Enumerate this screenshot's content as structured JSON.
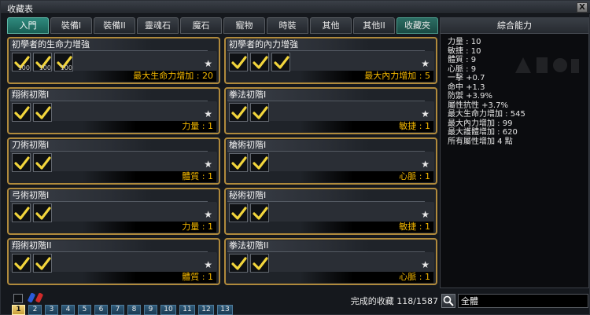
{
  "window": {
    "title": "收藏表",
    "close_label": "X"
  },
  "tabs": [
    {
      "label": "入門",
      "active": true
    },
    {
      "label": "裝備I"
    },
    {
      "label": "裝備II"
    },
    {
      "label": "靈魂石"
    },
    {
      "label": "魔石"
    },
    {
      "label": "寵物"
    },
    {
      "label": "時裝"
    },
    {
      "label": "其他"
    },
    {
      "label": "其他II"
    },
    {
      "label": "收藏夾"
    }
  ],
  "cards": [
    {
      "title": "初學者的生命力增強",
      "slots": 3,
      "slot_numbers": [
        "100",
        "100",
        "100"
      ],
      "stat": "最大生命力增加 : 20"
    },
    {
      "title": "初學者的內力增強",
      "slots": 3,
      "slot_numbers": [
        "",
        "",
        ""
      ],
      "stat": "最大內力增加 : 5"
    },
    {
      "title": "翔術初階I",
      "slots": 2,
      "slot_numbers": [
        "",
        ""
      ],
      "stat": "力量 : 1"
    },
    {
      "title": "拳法初階I",
      "slots": 2,
      "slot_numbers": [
        "",
        ""
      ],
      "stat": "敏捷 : 1"
    },
    {
      "title": "刀術初階I",
      "slots": 2,
      "slot_numbers": [
        "",
        ""
      ],
      "stat": "體質 : 1"
    },
    {
      "title": "槍術初階I",
      "slots": 2,
      "slot_numbers": [
        "",
        ""
      ],
      "stat": "心脈 : 1"
    },
    {
      "title": "弓術初階I",
      "slots": 2,
      "slot_numbers": [
        "",
        ""
      ],
      "stat": "力量 : 1"
    },
    {
      "title": "秘術初階I",
      "slots": 2,
      "slot_numbers": [
        "",
        ""
      ],
      "stat": "敏捷 : 1"
    },
    {
      "title": "翔術初階II",
      "slots": 2,
      "slot_numbers": [
        "",
        ""
      ],
      "stat": "體質 : 1"
    },
    {
      "title": "拳法初階II",
      "slots": 2,
      "slot_numbers": [
        "",
        ""
      ],
      "stat": "心脈 : 1"
    }
  ],
  "progress": "完成的收藏 118/1587",
  "pages": [
    "1",
    "2",
    "3",
    "4",
    "5",
    "6",
    "7",
    "8",
    "9",
    "10",
    "11",
    "12",
    "13"
  ],
  "active_page": "1",
  "panel": {
    "title": "綜合能力",
    "stats": [
      "力量 : 10",
      "敏捷 : 10",
      "體質 : 9",
      "心脈 : 9",
      "一擊 +0.7",
      "命中 +1.3",
      "防禦 +3.9%",
      "屬性抗性 +3.7%",
      "最大生命力增加 : 545",
      "最大內力增加 : 99",
      "最大護體增加 : 620",
      "所有屬性增加 4 點"
    ]
  },
  "search": {
    "value": "全體"
  },
  "colors": {
    "frame_gold": "#b08a3c",
    "stat_yellow": "#f5b800",
    "tab_active": "#2f8a7e",
    "check_yellow": "#f2d53c"
  }
}
